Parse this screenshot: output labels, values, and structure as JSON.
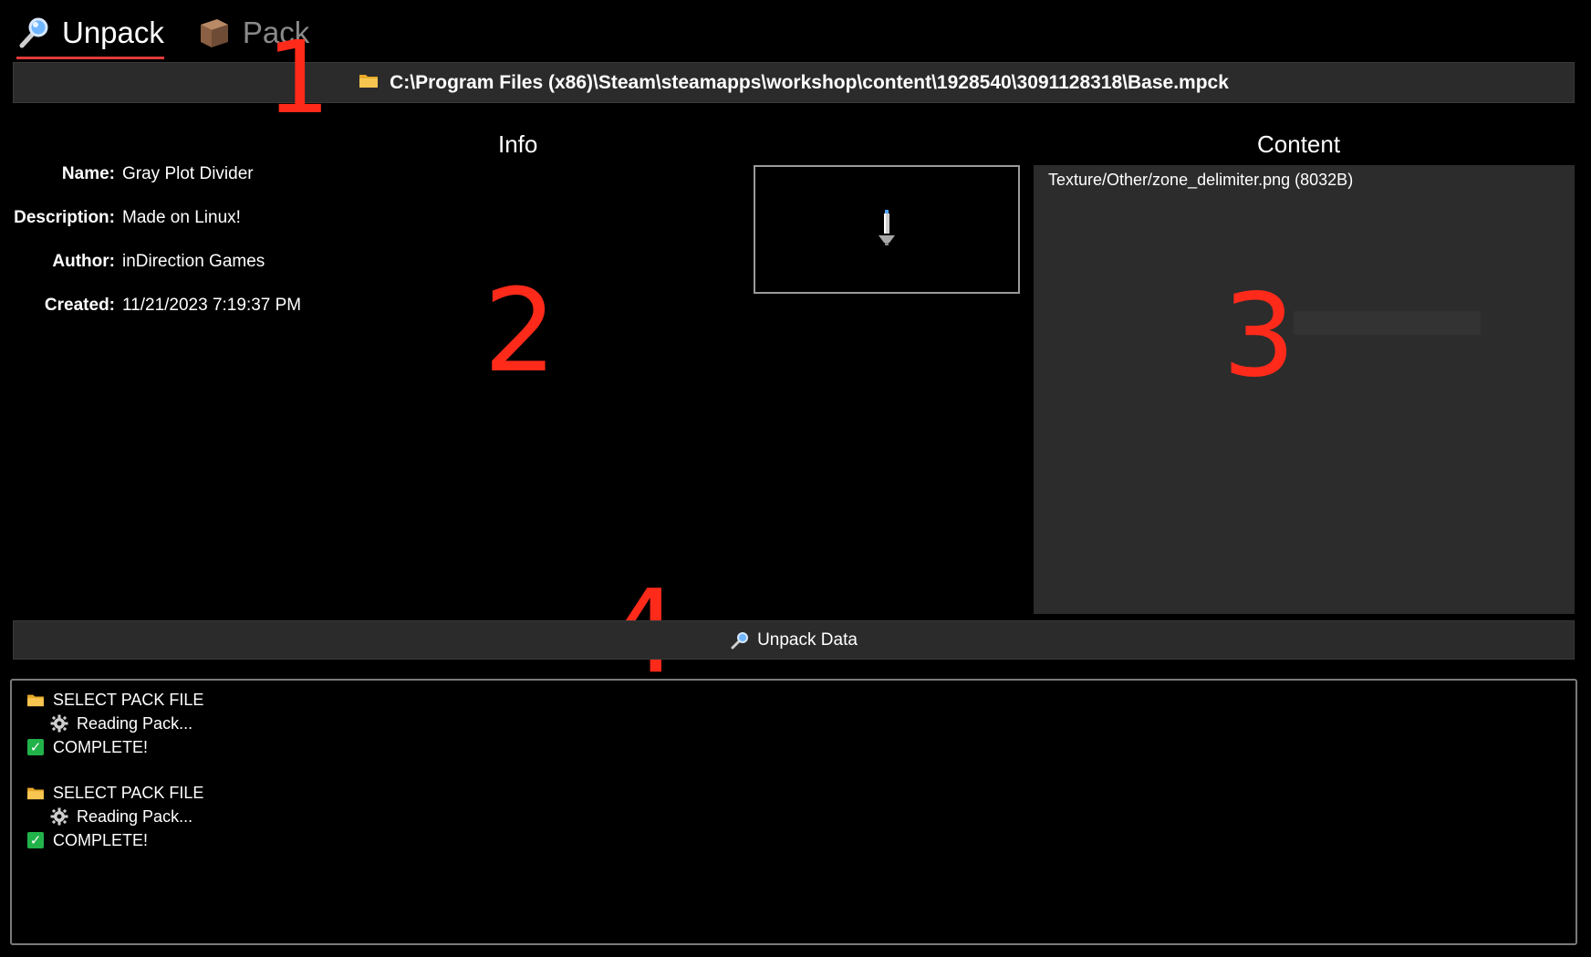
{
  "tabs": [
    {
      "label": "Unpack",
      "icon": "magnifier-icon",
      "active": true
    },
    {
      "label": "Pack",
      "icon": "box-icon",
      "active": false
    }
  ],
  "path_bar": {
    "icon": "folder-icon",
    "path": "C:\\Program Files (x86)\\Steam\\steamapps\\workshop\\content\\1928540\\3091128318\\Base.mpck"
  },
  "info": {
    "header": "Info",
    "rows": [
      {
        "label": "Name:",
        "value": "Gray Plot Divider"
      },
      {
        "label": "Description:",
        "value": "Made on Linux!"
      },
      {
        "label": "Author:",
        "value": "inDirection Games"
      },
      {
        "label": "Created:",
        "value": "11/21/2023 7:19:37 PM"
      }
    ]
  },
  "content": {
    "header": "Content",
    "items": [
      "Texture/Other/zone_delimiter.png (8032B)"
    ]
  },
  "unpack_button": {
    "label": "Unpack Data",
    "icon": "magnifier-icon"
  },
  "log": [
    {
      "level": 0,
      "icon": "folder-icon",
      "text": "SELECT PACK FILE"
    },
    {
      "level": 1,
      "icon": "gear-icon",
      "text": "Reading Pack..."
    },
    {
      "level": 0,
      "icon": "check-icon",
      "text": "COMPLETE!"
    },
    {
      "gap": true
    },
    {
      "level": 0,
      "icon": "folder-icon",
      "text": "SELECT PACK FILE"
    },
    {
      "level": 1,
      "icon": "gear-icon",
      "text": "Reading Pack..."
    },
    {
      "level": 0,
      "icon": "check-icon",
      "text": "COMPLETE!"
    }
  ],
  "annotations": [
    "1",
    "2",
    "3",
    "4"
  ],
  "colors": {
    "background": "#000000",
    "bar": "#2b2b2b",
    "content_panel": "#2c2c2c",
    "tab_underline": "#e03a3a",
    "annotation": "#ff2a1a",
    "check": "#21b24a"
  }
}
